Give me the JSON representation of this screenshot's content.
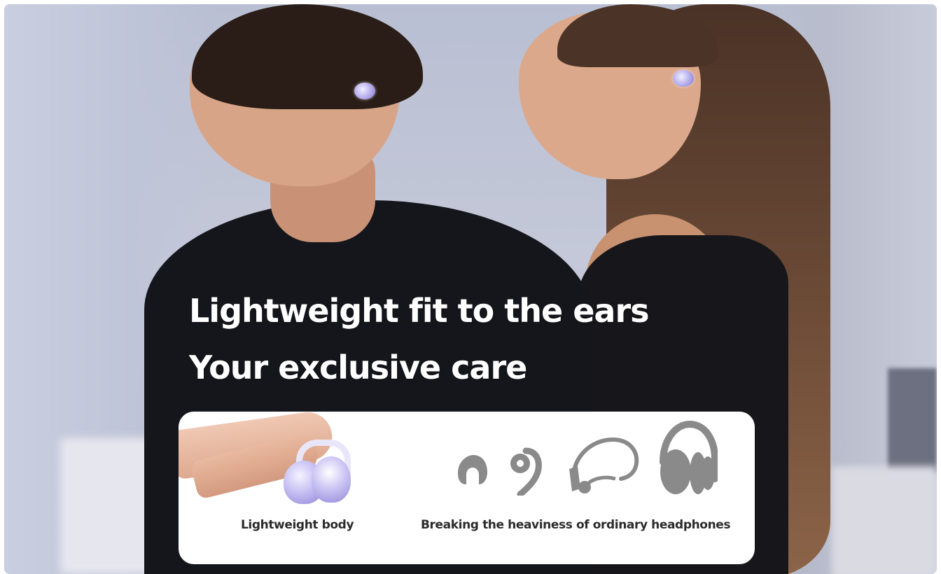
{
  "headline": {
    "line1": "Lightweight fit to the ears",
    "line2": "Your exclusive care"
  },
  "card": {
    "left_label": "Lightweight body",
    "right_label": "Breaking the heaviness of ordinary headphones",
    "icons": [
      "in-ear-earbud-icon",
      "ear-hook-icon",
      "neckband-headphone-icon",
      "over-ear-headphone-icon"
    ]
  },
  "colors": {
    "headline_text": "#ffffff",
    "card_background": "#ffffff",
    "icon_gray": "#8a8a8a",
    "earbud_lavender": "#b9b0ef"
  }
}
